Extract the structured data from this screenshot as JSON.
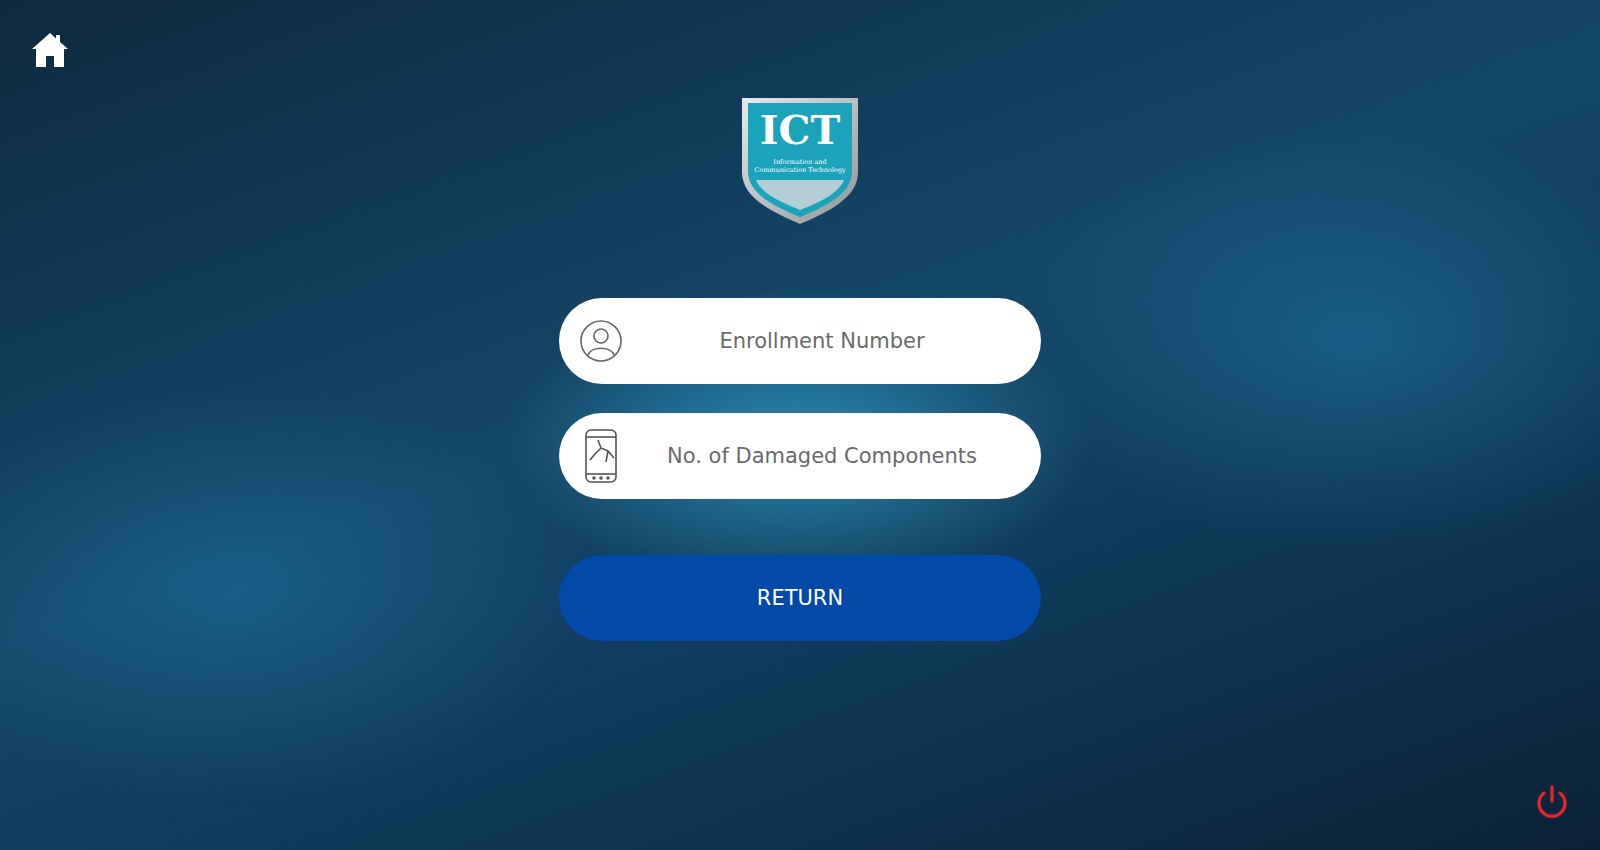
{
  "logo": {
    "title": "ICT",
    "subtitle": [
      "Information and",
      "Communication Technology"
    ]
  },
  "form": {
    "fields": [
      {
        "placeholder": "Enrollment Number",
        "kind": "user"
      },
      {
        "placeholder": "No. of Damaged Components",
        "kind": "phone"
      }
    ],
    "submit": "RETURN"
  }
}
